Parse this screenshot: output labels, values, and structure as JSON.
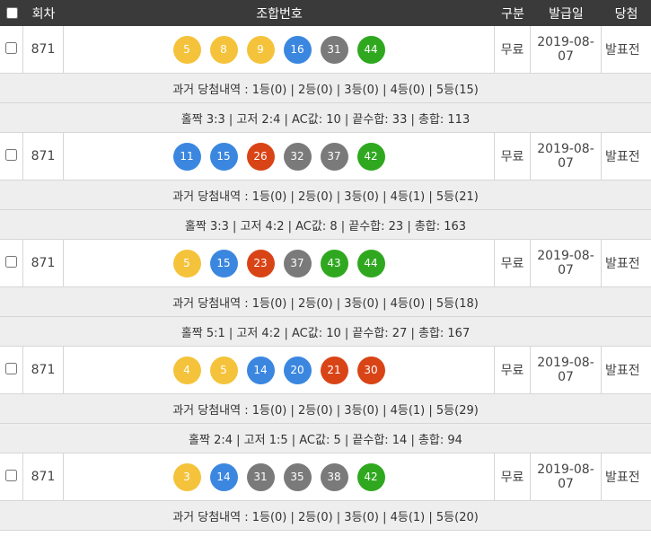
{
  "header": {
    "round": "회차",
    "numbers": "조합번호",
    "type": "구분",
    "date": "발급일",
    "result": "당첨"
  },
  "colors": {
    "yellow": "#f5c33b",
    "blue": "#3b87e0",
    "red": "#d94416",
    "gray": "#7a7a7a",
    "green": "#2fa81f",
    "header_bg": "#3a3a3a"
  },
  "tickets": [
    {
      "round": "871",
      "balls": [
        {
          "n": "5",
          "c": "yellow"
        },
        {
          "n": "8",
          "c": "yellow"
        },
        {
          "n": "9",
          "c": "yellow"
        },
        {
          "n": "16",
          "c": "blue"
        },
        {
          "n": "31",
          "c": "gray"
        },
        {
          "n": "44",
          "c": "green"
        }
      ],
      "type": "무료",
      "date": "2019-08-07",
      "result": "발표전",
      "history": "과거 당첨내역 : 1등(0) | 2등(0) | 3등(0) | 4등(0) | 5등(15)",
      "stats": "홀짝 3:3 | 고저 2:4 | AC값: 10 | 끝수합: 33 | 총합: 113"
    },
    {
      "round": "871",
      "balls": [
        {
          "n": "11",
          "c": "blue"
        },
        {
          "n": "15",
          "c": "blue"
        },
        {
          "n": "26",
          "c": "red"
        },
        {
          "n": "32",
          "c": "gray"
        },
        {
          "n": "37",
          "c": "gray"
        },
        {
          "n": "42",
          "c": "green"
        }
      ],
      "type": "무료",
      "date": "2019-08-07",
      "result": "발표전",
      "history": "과거 당첨내역 : 1등(0) | 2등(0) | 3등(0) | 4등(1) | 5등(21)",
      "stats": "홀짝 3:3 | 고저 4:2 | AC값: 8 | 끝수합: 23 | 총합: 163"
    },
    {
      "round": "871",
      "balls": [
        {
          "n": "5",
          "c": "yellow"
        },
        {
          "n": "15",
          "c": "blue"
        },
        {
          "n": "23",
          "c": "red"
        },
        {
          "n": "37",
          "c": "gray"
        },
        {
          "n": "43",
          "c": "green"
        },
        {
          "n": "44",
          "c": "green"
        }
      ],
      "type": "무료",
      "date": "2019-08-07",
      "result": "발표전",
      "history": "과거 당첨내역 : 1등(0) | 2등(0) | 3등(0) | 4등(0) | 5등(18)",
      "stats": "홀짝 5:1 | 고저 4:2 | AC값: 10 | 끝수합: 27 | 총합: 167"
    },
    {
      "round": "871",
      "balls": [
        {
          "n": "4",
          "c": "yellow"
        },
        {
          "n": "5",
          "c": "yellow"
        },
        {
          "n": "14",
          "c": "blue"
        },
        {
          "n": "20",
          "c": "blue"
        },
        {
          "n": "21",
          "c": "red"
        },
        {
          "n": "30",
          "c": "red"
        }
      ],
      "type": "무료",
      "date": "2019-08-07",
      "result": "발표전",
      "history": "과거 당첨내역 : 1등(0) | 2등(0) | 3등(0) | 4등(1) | 5등(29)",
      "stats": "홀짝 2:4 | 고저 1:5 | AC값: 5 | 끝수합: 14 | 총합: 94"
    },
    {
      "round": "871",
      "balls": [
        {
          "n": "3",
          "c": "yellow"
        },
        {
          "n": "14",
          "c": "blue"
        },
        {
          "n": "31",
          "c": "gray"
        },
        {
          "n": "35",
          "c": "gray"
        },
        {
          "n": "38",
          "c": "gray"
        },
        {
          "n": "42",
          "c": "green"
        }
      ],
      "type": "무료",
      "date": "2019-08-07",
      "result": "발표전",
      "history": "과거 당첨내역 : 1등(0) | 2등(0) | 3등(0) | 4등(1) | 5등(20)",
      "stats": ""
    }
  ]
}
